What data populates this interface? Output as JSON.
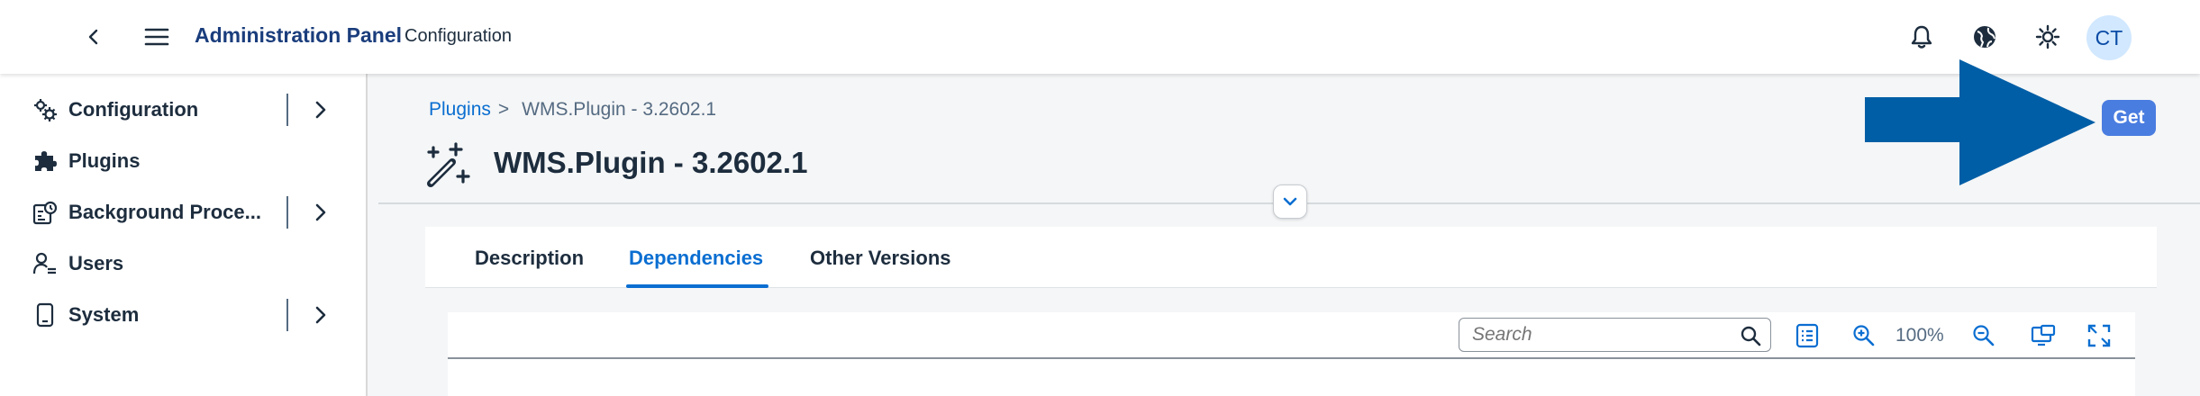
{
  "shell": {
    "title": "Administration Panel",
    "subtitle": "Configuration",
    "avatar_initials": "CT",
    "icons": [
      "back-icon",
      "menu-icon",
      "bell-icon",
      "globe-icon",
      "theme-icon"
    ]
  },
  "sidenav": {
    "items": [
      {
        "label": "Configuration",
        "icon": "settings-icon",
        "expandable": true
      },
      {
        "label": "Plugins",
        "icon": "puzzle-icon",
        "expandable": false
      },
      {
        "label": "Background Proce...",
        "icon": "background-process-icon",
        "expandable": true
      },
      {
        "label": "Users",
        "icon": "user-icon",
        "expandable": false
      },
      {
        "label": "System",
        "icon": "device-icon",
        "expandable": true
      }
    ]
  },
  "header": {
    "breadcrumb": {
      "link": "Plugins",
      "separator": ">",
      "current": "WMS.Plugin - 3.2602.1"
    },
    "title": "WMS.Plugin - 3.2602.1",
    "icon": "magic-wand-icon",
    "action_label": "Get"
  },
  "tabs": [
    {
      "label": "Description",
      "selected": false
    },
    {
      "label": "Dependencies",
      "selected": true
    },
    {
      "label": "Other Versions",
      "selected": false
    }
  ],
  "toolbar": {
    "search_placeholder": "Search",
    "zoom_level": "100%"
  },
  "colors": {
    "accent": "#0a6ed1",
    "button": "#4a7de0",
    "arrow": "#005ea6",
    "shell_title": "#1a3d7c"
  }
}
